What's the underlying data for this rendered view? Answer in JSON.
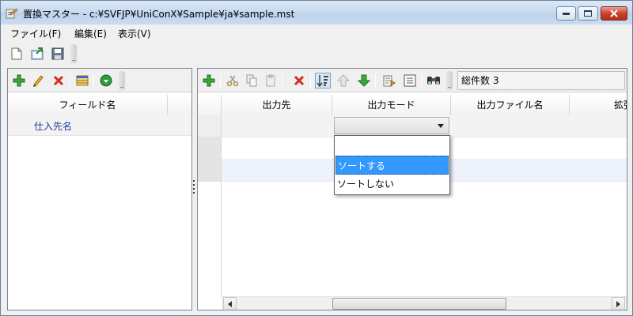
{
  "window": {
    "title": "置換マスター - c:¥SVFJP¥UniConX¥Sample¥ja¥sample.mst",
    "app_icon": "app-icon"
  },
  "menu": [
    {
      "label": "ファイル(F)"
    },
    {
      "label": "編集(E)"
    },
    {
      "label": "表示(V)"
    }
  ],
  "main_toolbar": {
    "icons": [
      "new-file-icon",
      "open-file-icon",
      "save-icon"
    ]
  },
  "left_panel": {
    "toolbar_icons": [
      "add-icon",
      "edit-icon",
      "delete-icon",
      "table-icon",
      "green-circle-icon"
    ],
    "column_header": "フィールド名",
    "rows": [
      "仕入先名"
    ]
  },
  "right_panel": {
    "toolbar_icons": [
      "add-icon",
      "cut-icon",
      "copy-icon",
      "paste-icon",
      "delete-icon",
      "sort-icon",
      "up-arrow-icon",
      "down-arrow-icon",
      "export-icon",
      "list-icon",
      "find-icon"
    ],
    "total_count_label": "総件数 3",
    "columns": [
      "出力先",
      "出力モード",
      "出力ファイル名",
      "拡張"
    ],
    "dropdown": {
      "value": "",
      "options": [
        "",
        "ソートする",
        "ソートしない"
      ],
      "highlighted_index": 1
    }
  },
  "colors": {
    "selection": "#3399ff",
    "field_text": "#1f3a93",
    "title_gradient_top": "#dbe8f6"
  }
}
